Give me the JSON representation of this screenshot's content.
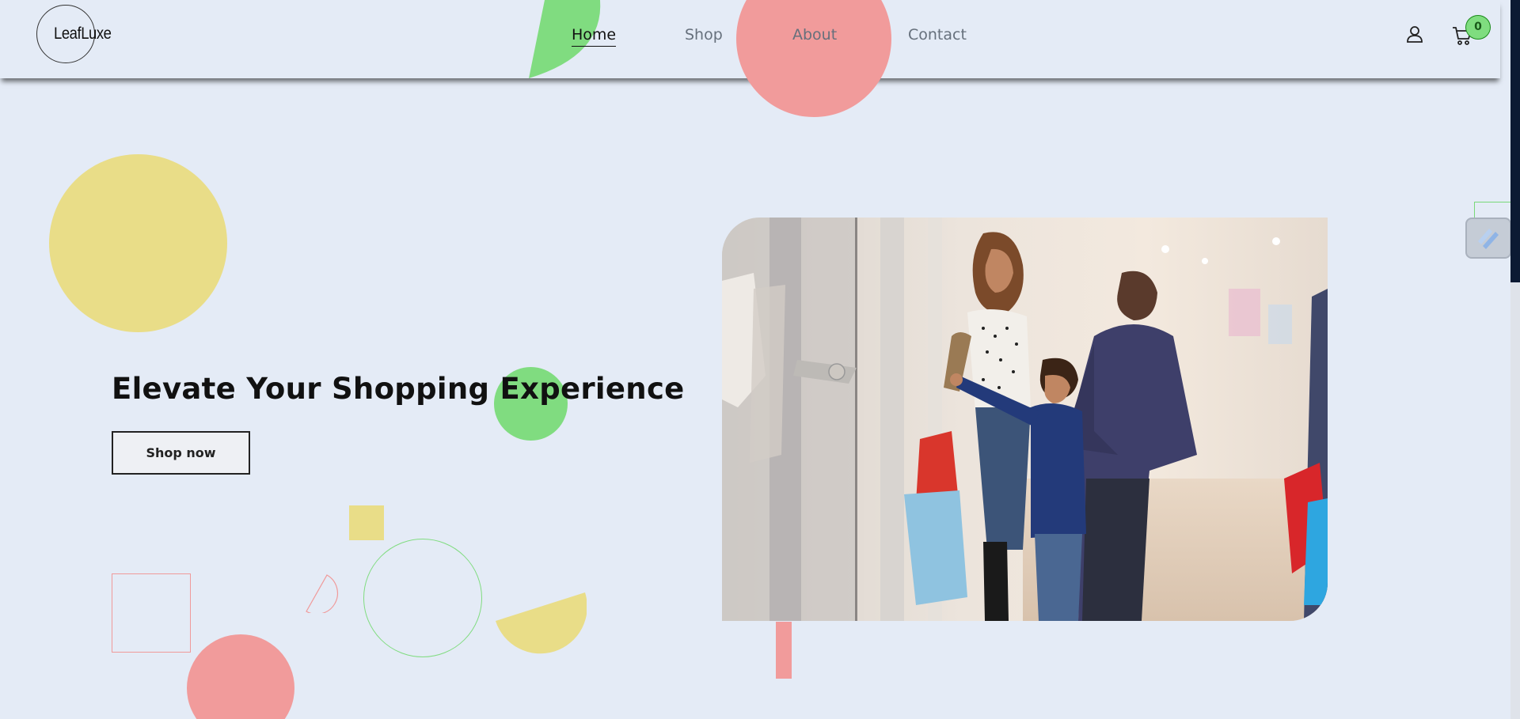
{
  "brand": {
    "name": "LeafLuxe"
  },
  "nav": {
    "items": [
      {
        "label": "Home",
        "active": true
      },
      {
        "label": "Shop",
        "active": false
      },
      {
        "label": "About",
        "active": false
      },
      {
        "label": "Contact",
        "active": false
      }
    ]
  },
  "header_actions": {
    "account_icon": "user-icon",
    "cart_icon": "cart-icon",
    "cart_count": "0"
  },
  "hero": {
    "title": "Elevate Your Shopping Experience",
    "cta_label": "Shop now",
    "image_description_icon": "family-shopping-photo"
  },
  "colors": {
    "background": "#e4ebf6",
    "accent_green": "#7fdd7f",
    "accent_pink": "#f09a9a",
    "accent_yellow": "#e9dc86",
    "text": "#111111",
    "nav_muted": "#66707c"
  }
}
